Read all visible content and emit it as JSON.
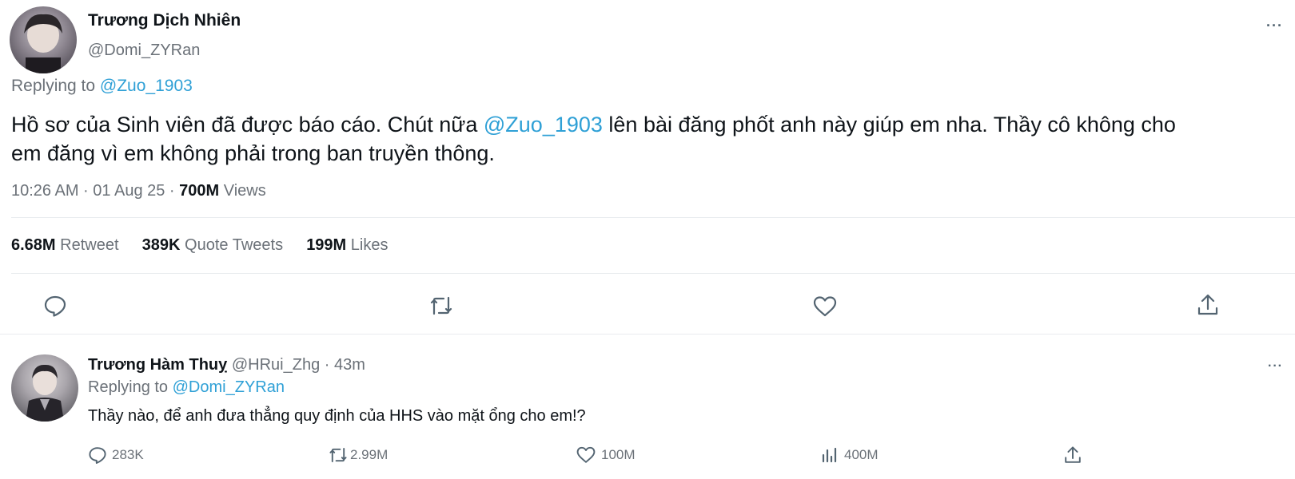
{
  "main_tweet": {
    "author_name": "Trương Dịch Nhiên",
    "author_handle": "@Domi_ZYRan",
    "replying_prefix": "Replying to ",
    "replying_to": "@Zuo_1903",
    "body_part1": "Hồ sơ của Sinh viên đã được báo cáo. Chút nữa ",
    "body_mention": "@Zuo_1903",
    "body_part2": " lên bài đăng phốt anh này giúp em nha. Thầy cô không cho",
    "body_line2": "em đăng vì em không phải trong ban truyền thông.",
    "meta_time": "10:26 AM · 01 Aug 25 · ",
    "views_count": "700M",
    "views_label": " Views",
    "stats": {
      "retweets_count": "6.68M",
      "retweets_label": " Retweet",
      "quotes_count": "389K",
      "quotes_label": " Quote Tweets",
      "likes_count": "199M",
      "likes_label": " Likes"
    },
    "more_label": "···",
    "actions": [
      "reply-icon",
      "retweet-icon",
      "like-icon",
      "share-icon"
    ]
  },
  "reply_tweet": {
    "author_name": "Trương Hàm Thuỵ",
    "author_handle": "@HRui_Zhg",
    "time": " · 43m",
    "replying_prefix": "Replying to ",
    "replying_to": "@Domi_ZYRan",
    "body": "Thầy nào, để anh đưa thẳng quy định của HHS vào mặt ổng cho em!?",
    "more_label": "···",
    "reply_count": "283K",
    "retweet_count": "2.99M",
    "like_count": "100M",
    "views_count": "400M"
  },
  "colors": {
    "link": "#2fa0d6",
    "text": "#0f1419",
    "secondary": "#6b7178",
    "divider": "#e9ecef"
  }
}
